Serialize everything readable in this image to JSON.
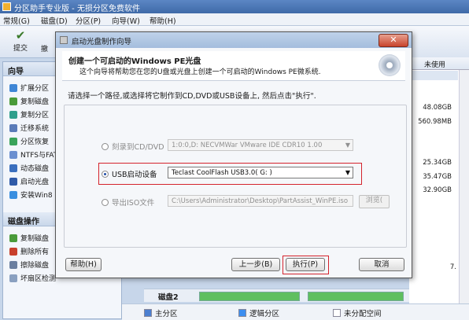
{
  "app": {
    "title": "分区助手专业版 - 无损分区免费软件",
    "menu": [
      "常规(G)",
      "磁盘(D)",
      "分区(P)",
      "向导(W)",
      "帮助(H)"
    ],
    "toolbar": {
      "submit": "提交",
      "hidden_label": "撤"
    }
  },
  "sidebar": {
    "wizard_title": "向导",
    "wizard_items": [
      "扩展分区",
      "复制磁盘",
      "复制分区",
      "迁移系统",
      "分区恢复",
      "NTFS与FAT",
      "动态磁盘",
      "启动光盘",
      "安装Win8"
    ],
    "disk_ops_title": "磁盘操作",
    "disk_ops_items": [
      "复制磁盘",
      "删除所有",
      "擦除磁盘",
      "坏扇区检测"
    ]
  },
  "right_pane": {
    "column_header": "未使用",
    "values": [
      "48.08GB",
      "560.98MB",
      "25.34GB",
      "35.47GB",
      "32.90GB"
    ],
    "markers": [
      "7."
    ]
  },
  "disk2": {
    "label": "磁盘2"
  },
  "legend": {
    "items": [
      {
        "label": "主分区",
        "color": "#4c7fd0"
      },
      {
        "label": "逻辑分区",
        "color": "#3c8ef0"
      },
      {
        "label": "未分配空间",
        "color": "#ffffff"
      }
    ]
  },
  "dialog": {
    "title": "启动光盘制作向导",
    "close_label": "✕",
    "heading": "创建一个可启动的Windows PE光盘",
    "subheading": "这个向导将帮助您在您的U盘或光盘上创建一个可启动的Windows PE微系统.",
    "instruction": "请选择一个路径,或选择将它制作到CD,DVD或USB设备上, 然后点击\"执行\".",
    "options": {
      "cd_label": "刻录到CD/DVD",
      "cd_value": "1:0:0,D: NECVMWar VMware IDE CDR10 1.00",
      "usb_label": "USB启动设备",
      "usb_value": "Teclast CoolFlash USB3.0( G: )",
      "iso_label": "导出ISO文件",
      "iso_value": "C:\\Users\\Administrator\\Desktop\\PartAssist_WinPE.iso",
      "browse_label": "浏览(",
      "selected": "usb"
    },
    "buttons": {
      "help": "帮助(H)",
      "back": "上一步(B)",
      "execute": "执行(P)",
      "cancel": "取消"
    }
  },
  "colors": {
    "highlight_box": "#d4232c",
    "title_bar": "#4a76b6"
  }
}
